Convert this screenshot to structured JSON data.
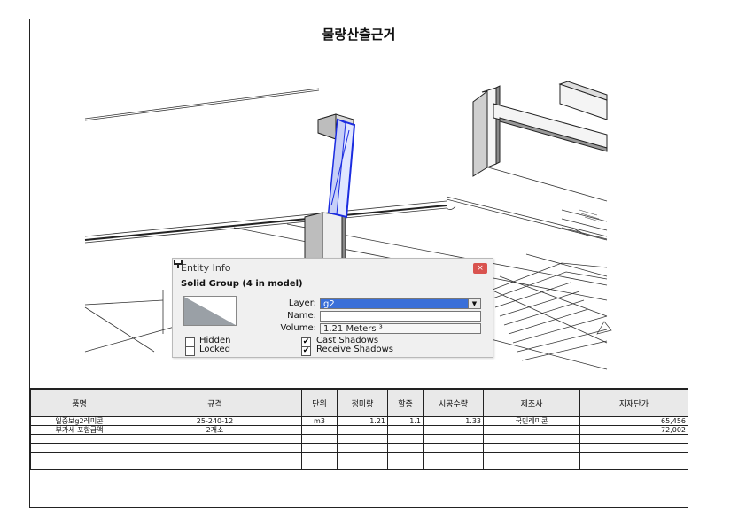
{
  "title": "물량산출근거",
  "entity_info": {
    "title": "Entity Info",
    "close_label": "×",
    "heading": "Solid Group (4 in model)",
    "layer_label": "Layer:",
    "layer_value": "g2",
    "layer_dropdown_icon": "▼",
    "name_label": "Name:",
    "name_value": "",
    "volume_label": "Volume:",
    "volume_value": "1.21 Meters ³",
    "hidden_label": "Hidden",
    "hidden_checked": false,
    "locked_label": "Locked",
    "locked_checked": false,
    "cast_shadows_label": "Cast Shadows",
    "cast_shadows_checked": true,
    "receive_shadows_label": "Receive Shadows",
    "receive_shadows_checked": true,
    "check_glyph": "✔",
    "icons": [
      "close-icon",
      "pin-icon",
      "chevron-down-icon"
    ]
  },
  "table": {
    "headers": [
      "품명",
      "규격",
      "단위",
      "정미량",
      "할증",
      "시공수량",
      "제조사",
      "자재단가"
    ],
    "rows": [
      [
        "일중보g2레미콘",
        "25-240-12",
        "m3",
        "1.21",
        "1.1",
        "1.33",
        "국민레미콘",
        "65,456"
      ],
      [
        "부가세 포함금액",
        "2개소",
        "",
        "",
        "",
        "",
        "",
        "72,002"
      ],
      [
        "",
        "",
        "",
        "",
        "",
        "",
        "",
        ""
      ],
      [
        "",
        "",
        "",
        "",
        "",
        "",
        "",
        ""
      ],
      [
        "",
        "",
        "",
        "",
        "",
        "",
        "",
        ""
      ],
      [
        "",
        "",
        "",
        "",
        "",
        "",
        "",
        ""
      ]
    ]
  },
  "colors": {
    "selection": "#1a2be0",
    "dialog_bg": "#f0f0f0",
    "layer_highlight": "#3a6fd8",
    "close_button": "#d9534f",
    "header_bg": "#e9e9e9"
  }
}
